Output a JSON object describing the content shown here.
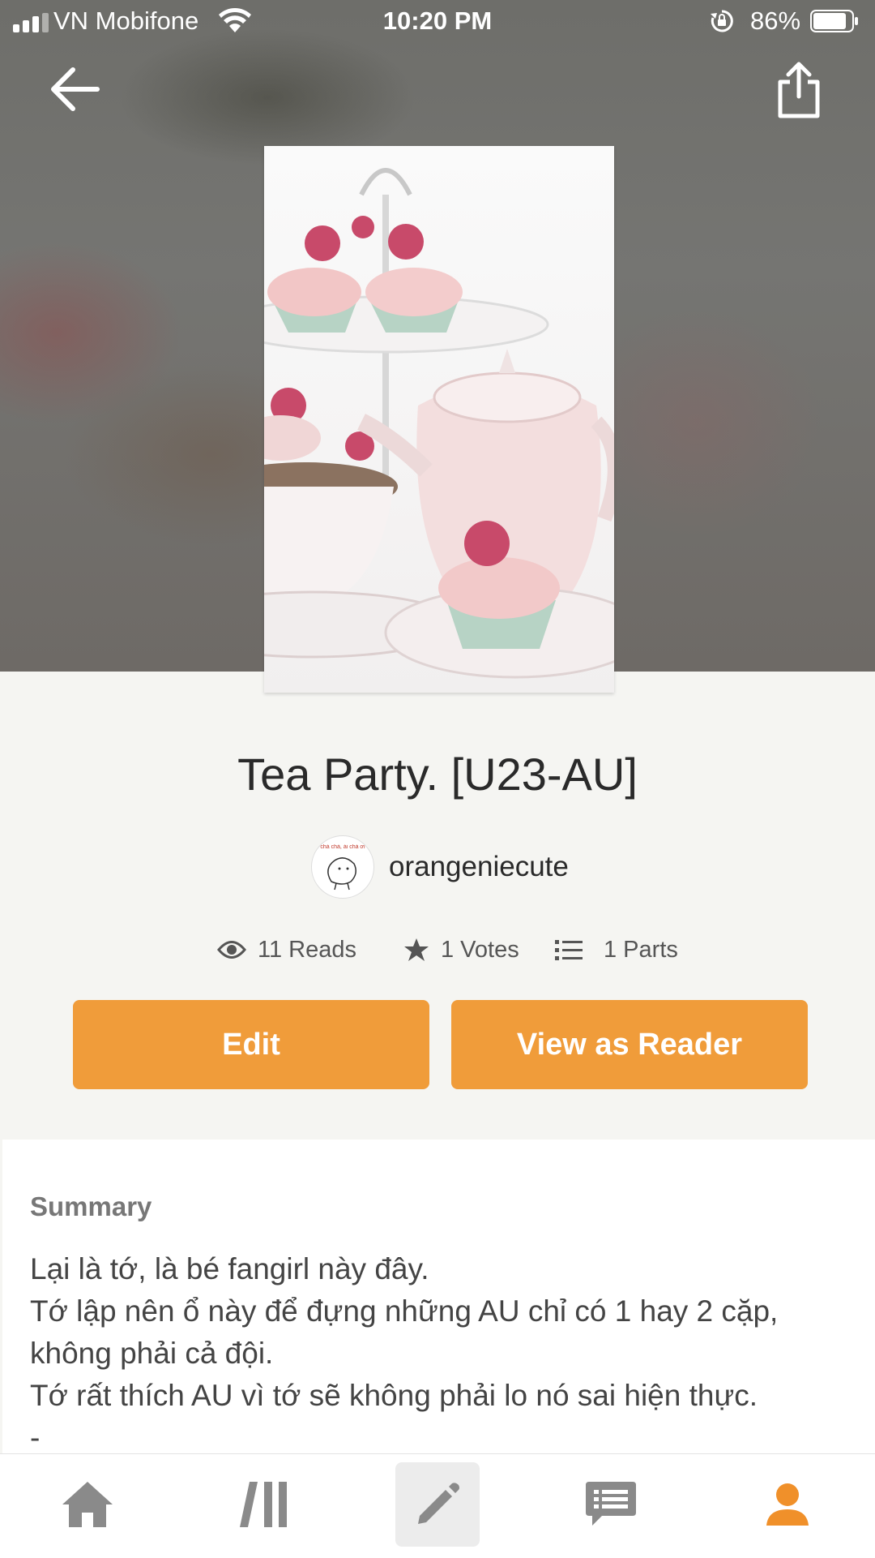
{
  "status_bar": {
    "carrier": "VN Mobifone",
    "time": "10:20 PM",
    "battery_percent": "86%",
    "battery_level": 0.86,
    "signal_bars": 3
  },
  "header": {
    "back_icon": "arrow-left-icon",
    "share_icon": "share-icon"
  },
  "story": {
    "title": "Tea Party. [U23-AU]",
    "author": "orangeniecute",
    "avatar_caption": "chà chà, ái chà ơi",
    "stats": {
      "reads": "11 Reads",
      "votes": "1 Votes",
      "parts": "1 Parts"
    }
  },
  "actions": {
    "edit_label": "Edit",
    "view_label": "View as Reader"
  },
  "summary": {
    "heading": "Summary",
    "lines": [
      "Lại là tớ, là bé fangirl này đây.",
      "Tớ lập nên ổ này để đựng những AU chỉ có 1 hay 2 cặp,",
      "không phải cả đội.",
      "Tớ rất thích AU vì tớ sẽ không phải lo nó sai hiện thực.",
      "-"
    ]
  },
  "tabbar": {
    "items": [
      "home-icon",
      "library-icon",
      "write-icon",
      "messages-icon",
      "profile-icon"
    ],
    "active_color": "#f0902a",
    "inactive_color": "#8a8a8a"
  },
  "colors": {
    "accent": "#f09c3a"
  }
}
